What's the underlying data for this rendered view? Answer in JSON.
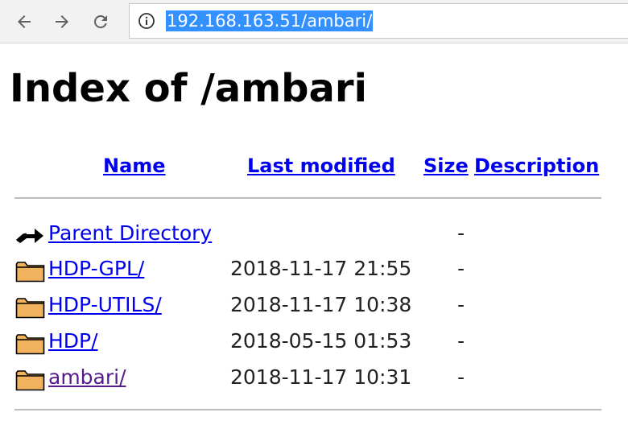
{
  "browser": {
    "url": "192.168.163.51/ambari/",
    "back_icon": "arrow-left-icon",
    "forward_icon": "arrow-right-icon",
    "reload_icon": "reload-icon",
    "info_icon": "info-circle-icon",
    "url_highlight_color": "#3390ff"
  },
  "page": {
    "title": "Index of /ambari"
  },
  "table": {
    "headers": {
      "name": "Name",
      "last_modified": "Last modified",
      "size": "Size",
      "description": "Description"
    },
    "rows": [
      {
        "name": "Parent Directory",
        "date": "",
        "size": "-",
        "icon": "back-arrow-icon",
        "visited": false
      },
      {
        "name": "HDP-GPL/",
        "date": "2018-11-17 21:55",
        "size": "-",
        "icon": "folder-icon",
        "visited": false
      },
      {
        "name": "HDP-UTILS/",
        "date": "2018-11-17 10:38",
        "size": "-",
        "icon": "folder-icon",
        "visited": false
      },
      {
        "name": "HDP/",
        "date": "2018-05-15 01:53",
        "size": "-",
        "icon": "folder-icon",
        "visited": false
      },
      {
        "name": "ambari/",
        "date": "2018-11-17 10:31",
        "size": "-",
        "icon": "folder-icon",
        "visited": true
      }
    ]
  },
  "colors": {
    "link": "#0000ee",
    "visited_link": "#551a8b",
    "folder_fill": "#f0b25c"
  }
}
